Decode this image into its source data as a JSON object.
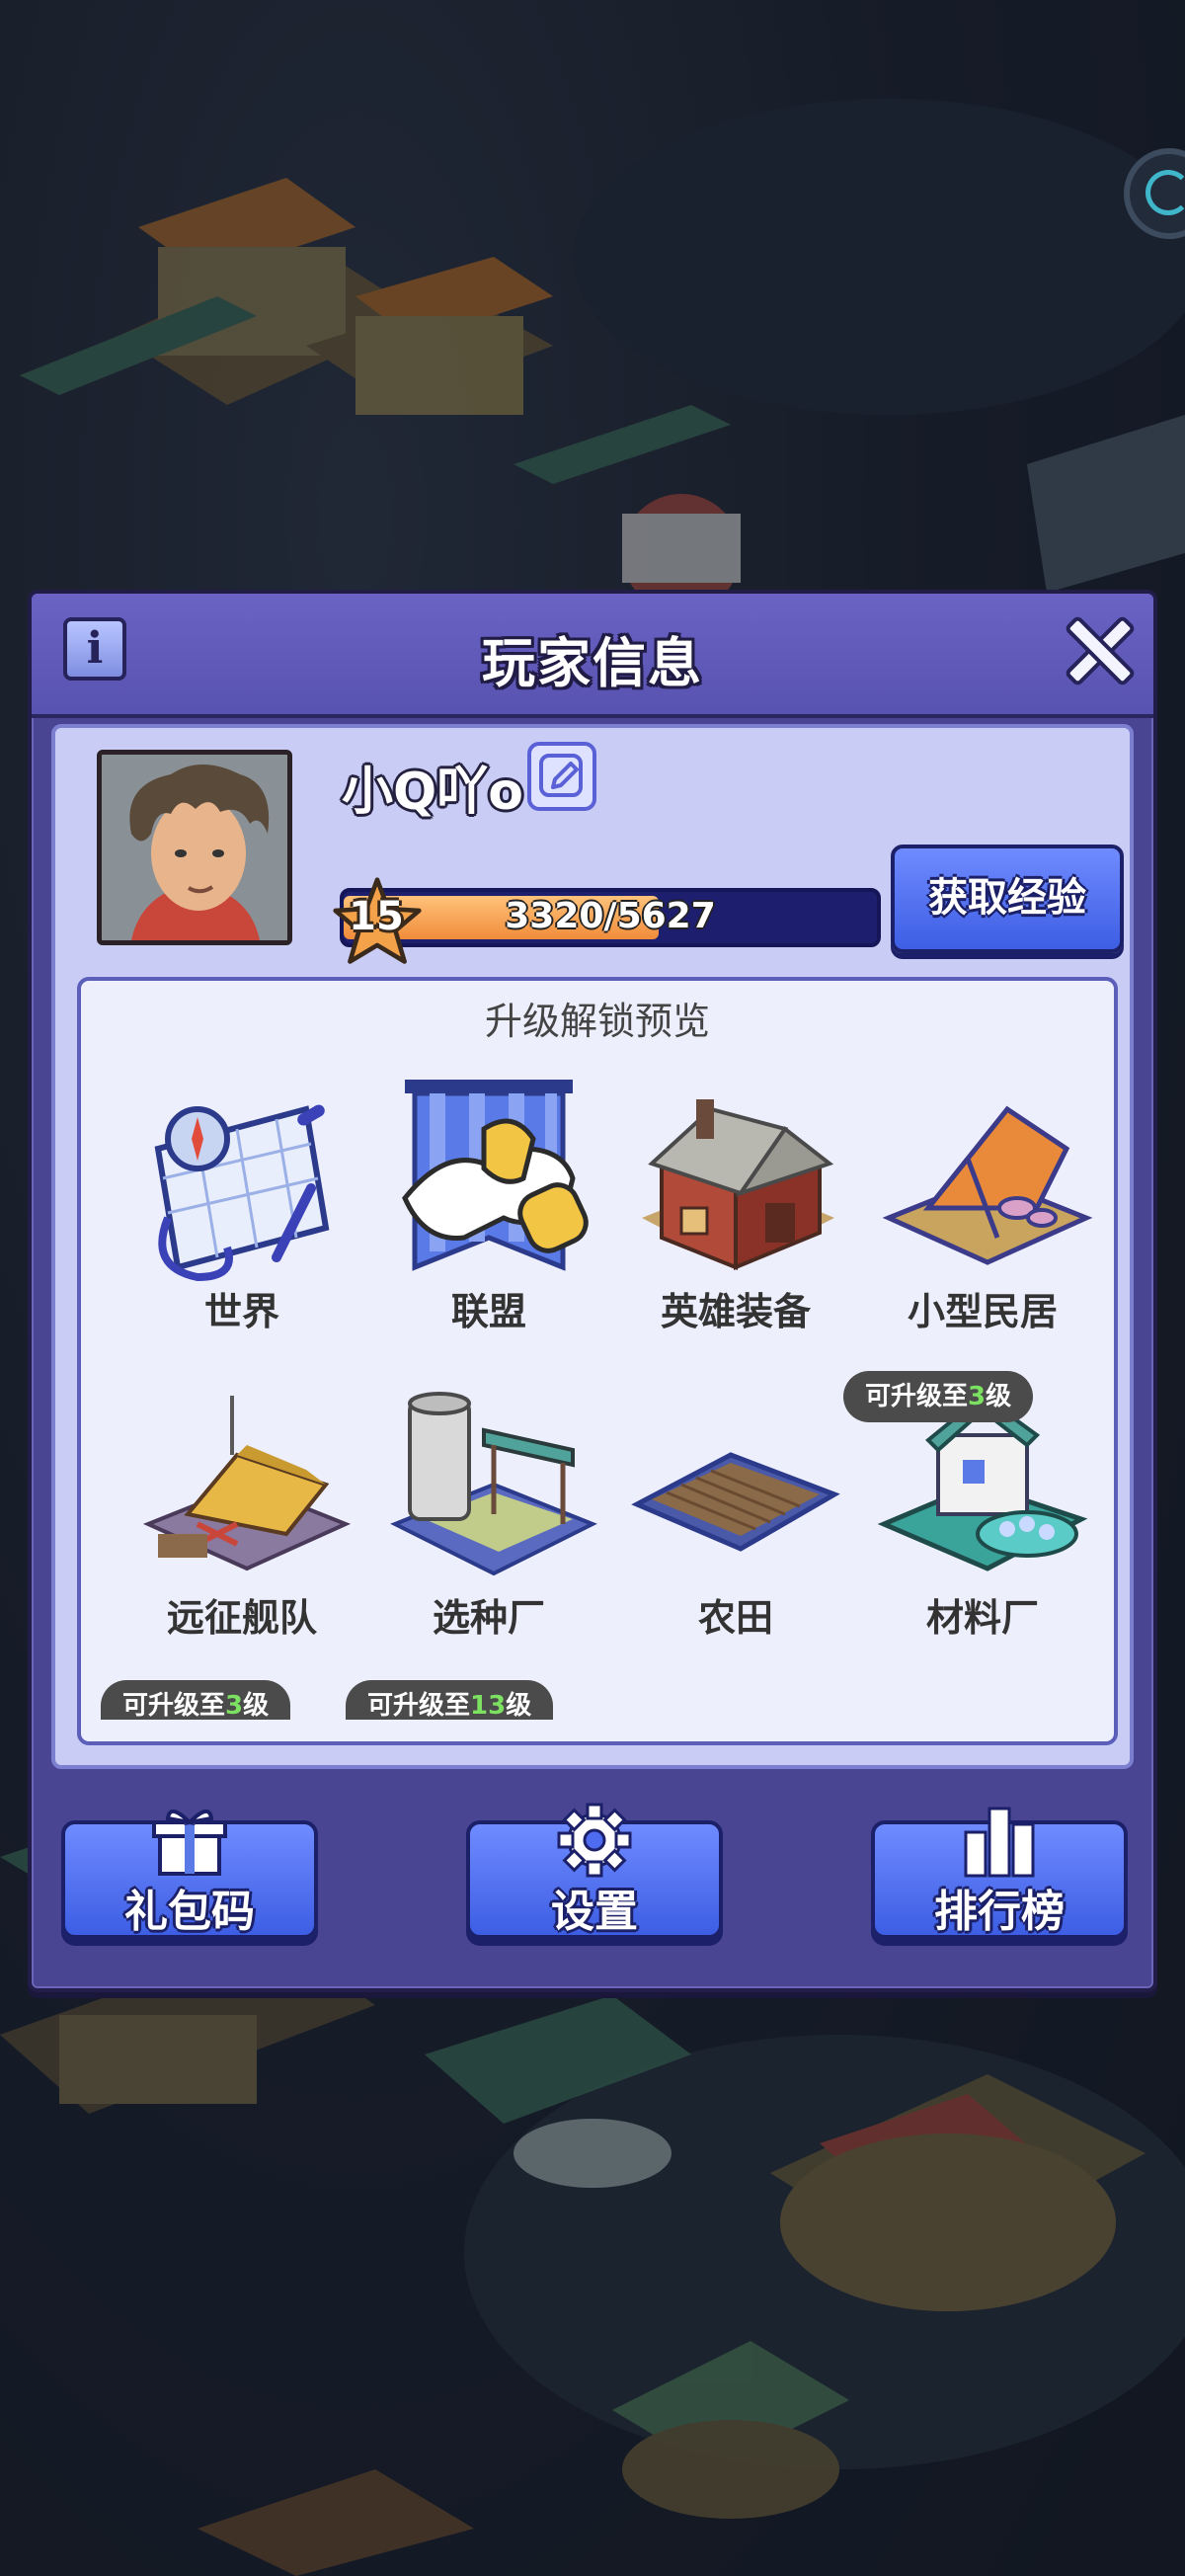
{
  "dialog": {
    "title": "玩家信息"
  },
  "player": {
    "name": "小Q吖o",
    "level": "15",
    "xp_text": "3320/5627",
    "xp_current": 3320,
    "xp_max": 5627,
    "get_exp_label": "获取经验"
  },
  "preview": {
    "title": "升级解锁预览",
    "items": [
      {
        "label": "世界",
        "icon": "world-map-icon"
      },
      {
        "label": "联盟",
        "icon": "alliance-banner-icon"
      },
      {
        "label": "英雄装备",
        "icon": "hero-equipment-house-icon"
      },
      {
        "label": "小型民居",
        "icon": "small-dwelling-tent-icon"
      },
      {
        "label": "远征舰队",
        "icon": "expedition-fleet-icon"
      },
      {
        "label": "选种厂",
        "icon": "seed-factory-icon"
      },
      {
        "label": "农田",
        "icon": "farmland-icon"
      },
      {
        "label": "材料厂",
        "icon": "material-factory-icon"
      }
    ],
    "badges": [
      {
        "prefix": "可升级至",
        "num": "3",
        "suffix": "级"
      },
      {
        "prefix": "可升级至",
        "num": "3",
        "suffix": "级"
      },
      {
        "prefix": "可升级至",
        "num": "13",
        "suffix": "级"
      }
    ]
  },
  "buttons": {
    "gift_code": "礼包码",
    "settings": "设置",
    "leaderboard": "排行榜"
  },
  "colors": {
    "panel": "#4a4592",
    "header": "#5f58b8",
    "content": "#c9ccf4",
    "button": "#4d6cf0",
    "xp_fill": "#f08c3a",
    "badge_number": "#7ce060"
  }
}
